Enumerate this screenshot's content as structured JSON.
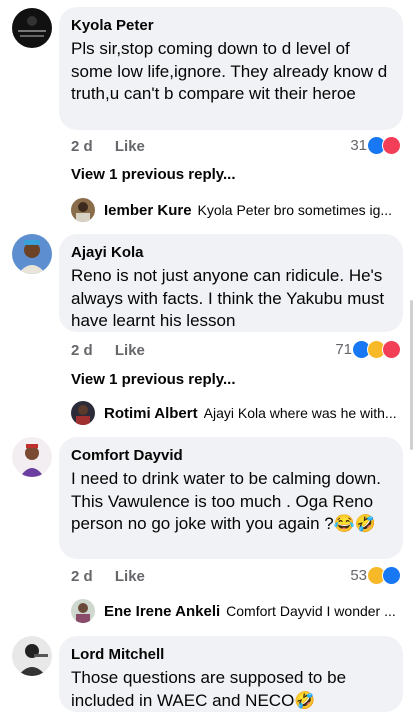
{
  "comments": [
    {
      "author": "Kyola Peter",
      "text": "Pls sir,stop coming down to d level of some low life,ignore. They already know d truth,u can't b compare wit their heroe",
      "time": "2 d",
      "like_label": "Like",
      "reaction_count": "31",
      "reactions": [
        "like-icon",
        "love-icon"
      ],
      "view_previous": "View 1 previous reply...",
      "reply": {
        "author": "Iember Kure",
        "text": "Kyola Peter bro sometimes ig..."
      }
    },
    {
      "author": "Ajayi Kola",
      "text": "Reno is not just anyone can ridicule. He's always with facts. I think the Yakubu must have learnt his lesson",
      "time": "2 d",
      "like_label": "Like",
      "reaction_count": "71",
      "reactions": [
        "like-icon",
        "haha-icon",
        "love-icon"
      ],
      "view_previous": "View 1 previous reply...",
      "reply": {
        "author": "Rotimi Albert",
        "text": "Ajayi Kola where was he with..."
      }
    },
    {
      "author": "Comfort Dayvid",
      "text": "I need to drink water to be calming down. This Vawulence is too much . Oga Reno person no go joke with you again ?😂🤣",
      "time": "2 d",
      "like_label": "Like",
      "reaction_count": "53",
      "reactions": [
        "haha-icon",
        "like-icon"
      ],
      "reply": {
        "author": "Ene Irene Ankeli",
        "text": "Comfort Dayvid I wonder ..."
      }
    },
    {
      "author": "Lord Mitchell",
      "text": "Those questions are supposed to be included in WAEC and NECO🤣"
    }
  ],
  "colors": {
    "like": "#1877f2",
    "love": "#f33e58",
    "haha": "#f7b928",
    "bubble": "#f0f2f5",
    "meta": "#65676b"
  }
}
